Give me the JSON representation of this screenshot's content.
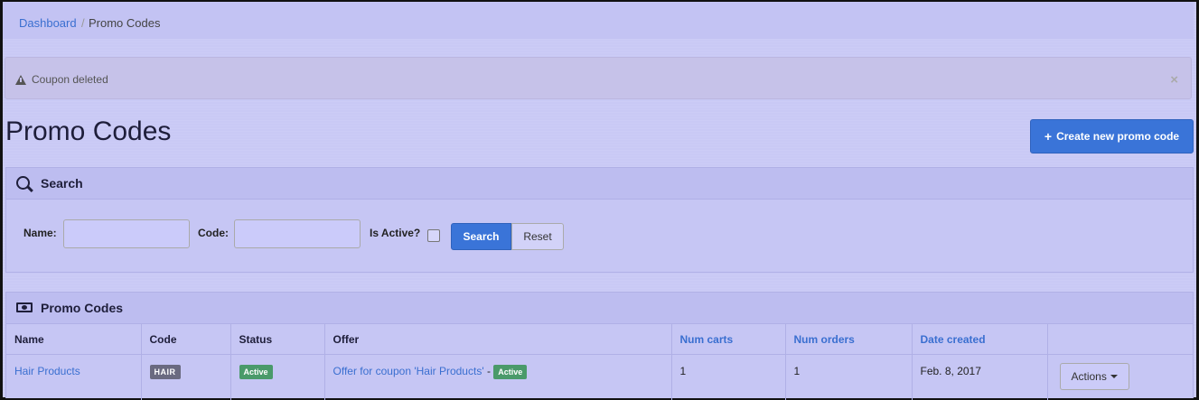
{
  "breadcrumb": {
    "home": "Dashboard",
    "separator": "/",
    "current": "Promo Codes"
  },
  "alert": {
    "message": "Coupon deleted",
    "close": "×"
  },
  "page": {
    "title": "Promo Codes",
    "create_button": "Create new promo code"
  },
  "search_panel": {
    "title": "Search",
    "name_label": "Name:",
    "name_value": "",
    "code_label": "Code:",
    "code_value": "",
    "active_label": "Is Active?",
    "active_checked": false,
    "search_button": "Search",
    "reset_button": "Reset"
  },
  "table_panel": {
    "title": "Promo Codes",
    "columns": [
      "Name",
      "Code",
      "Status",
      "Offer",
      "Num carts",
      "Num orders",
      "Date created",
      ""
    ],
    "rows": [
      {
        "name": "Hair Products",
        "code": "HAIR",
        "status": "Active",
        "offer": "Offer for coupon 'Hair Products'",
        "offer_sep": "-",
        "offer_status": "Active",
        "num_carts": "1",
        "num_orders": "1",
        "date_created": "Feb. 8, 2017",
        "actions": "Actions"
      }
    ]
  },
  "colors": {
    "accent": "#3a74d8",
    "link": "#3a6fd0",
    "success": "#4a9a6a",
    "background": "#c9c9f5"
  }
}
